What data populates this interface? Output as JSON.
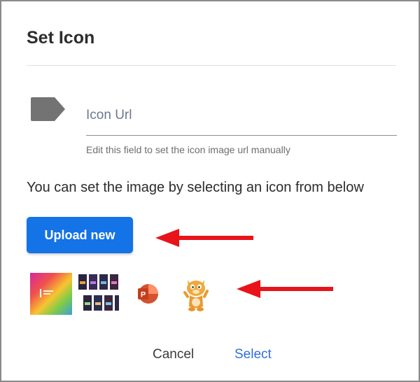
{
  "dialog": {
    "title": "Set Icon",
    "url_field": {
      "placeholder": "Icon Url",
      "value": "",
      "helper": "Edit this field to set the icon image url manually"
    },
    "instruction": "You can set the image by selecting an icon from below",
    "upload_button": "Upload new",
    "icon_options": [
      {
        "name": "gradient-app-icon"
      },
      {
        "name": "app-tiles-grid-icon"
      },
      {
        "name": "powerpoint-icon"
      },
      {
        "name": "cartoon-cat-icon"
      }
    ],
    "footer": {
      "cancel": "Cancel",
      "select": "Select"
    }
  },
  "colors": {
    "accent_blue": "#1473e6",
    "link_blue": "#2f6fdc",
    "annotation_red": "#e8141a",
    "tag_gray": "#737373"
  }
}
